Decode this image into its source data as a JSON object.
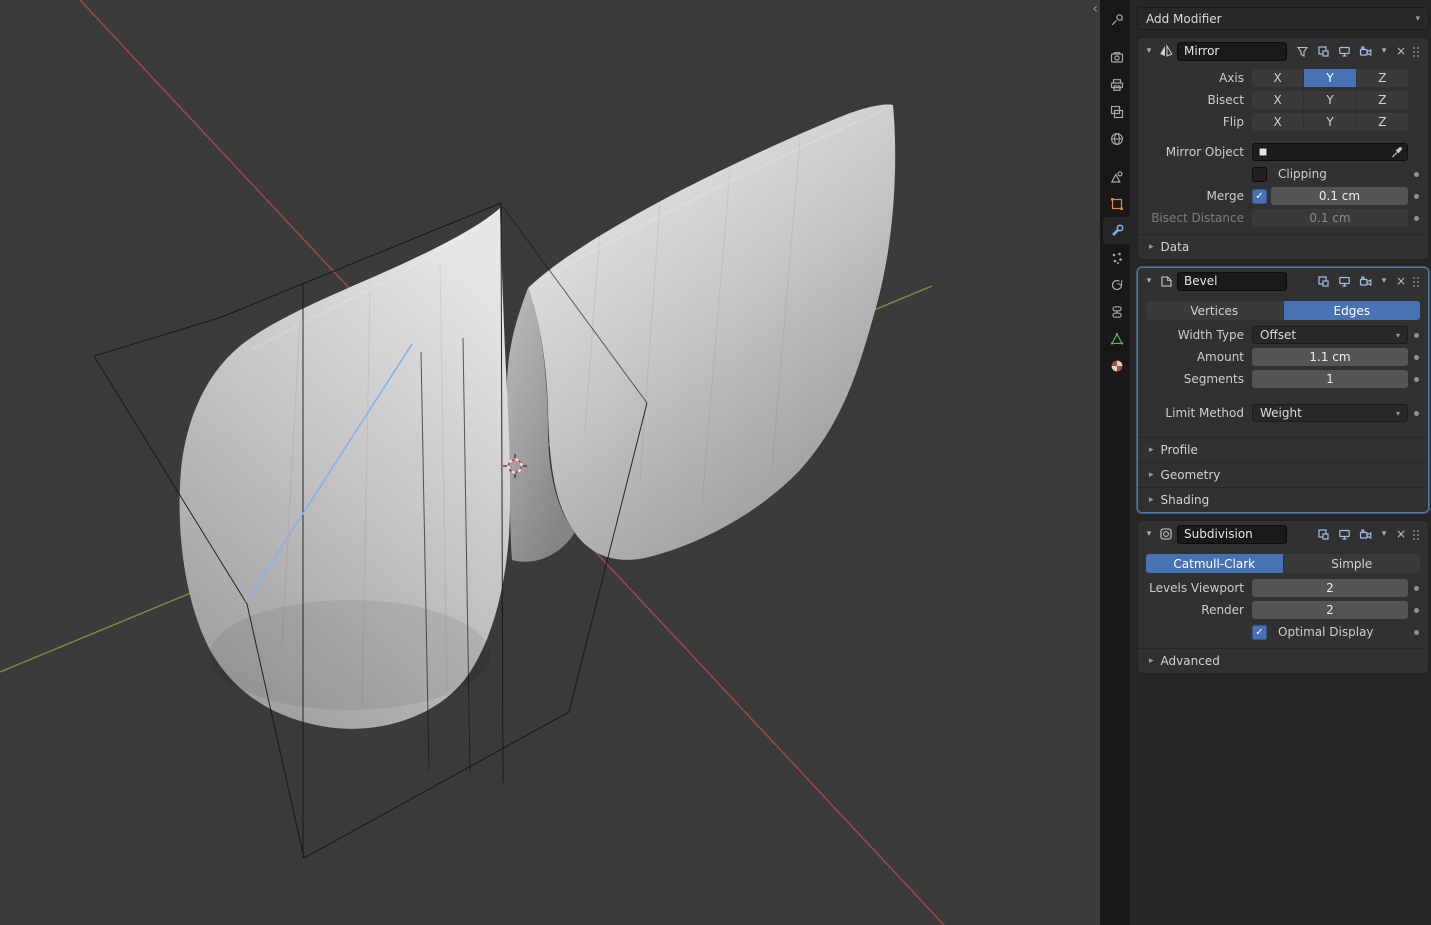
{
  "glyphs": {
    "chevron_down": "▾",
    "chevron_right": "▸",
    "close": "×",
    "collapse_left": "‹",
    "check": "✓"
  },
  "colors": {
    "accent_blue": "#4772b3",
    "selected_edge_blue": "#85b5e8",
    "axis_x_red": "#b84a4a",
    "axis_y_green": "#7d9c3e",
    "object_orange": "#dd8a3c",
    "modifier_wrench_blue": "#84aede",
    "data_green": "#5cb85c"
  },
  "viewport": {
    "cursor": "3d-cursor",
    "region_collapse": "‹"
  },
  "tab_strip": {
    "active": "modifiers",
    "items": [
      "tool",
      "render",
      "output",
      "view-layer",
      "world",
      "scene",
      "object",
      "modifiers",
      "particles",
      "physics",
      "constraints",
      "object-data",
      "material"
    ]
  },
  "properties": {
    "add_modifier_label": "Add Modifier",
    "mirror": {
      "title": "Mirror",
      "axis_label": "Axis",
      "bisect_label": "Bisect",
      "flip_label": "Flip",
      "x": "X",
      "y": "Y",
      "z": "Z",
      "axis_active": "Y",
      "mirror_object_label": "Mirror Object",
      "clipping_label": "Clipping",
      "merge_label": "Merge",
      "merge_value": "0.1 cm",
      "bisect_distance_label": "Bisect Distance",
      "bisect_distance_value": "0.1 cm",
      "data_section_label": "Data"
    },
    "bevel": {
      "title": "Bevel",
      "vertices_label": "Vertices",
      "edges_label": "Edges",
      "active_mode": "Edges",
      "width_type_label": "Width Type",
      "width_type_value": "Offset",
      "amount_label": "Amount",
      "amount_value": "1.1 cm",
      "segments_label": "Segments",
      "segments_value": "1",
      "limit_method_label": "Limit Method",
      "limit_method_value": "Weight",
      "profile_section_label": "Profile",
      "geometry_section_label": "Geometry",
      "shading_section_label": "Shading"
    },
    "subdivision": {
      "title": "Subdivision",
      "catmull_clark_label": "Catmull-Clark",
      "simple_label": "Simple",
      "active_mode": "Catmull-Clark",
      "levels_viewport_label": "Levels Viewport",
      "levels_viewport_value": "2",
      "render_label": "Render",
      "render_value": "2",
      "optimal_display_label": "Optimal Display",
      "advanced_section_label": "Advanced"
    }
  }
}
